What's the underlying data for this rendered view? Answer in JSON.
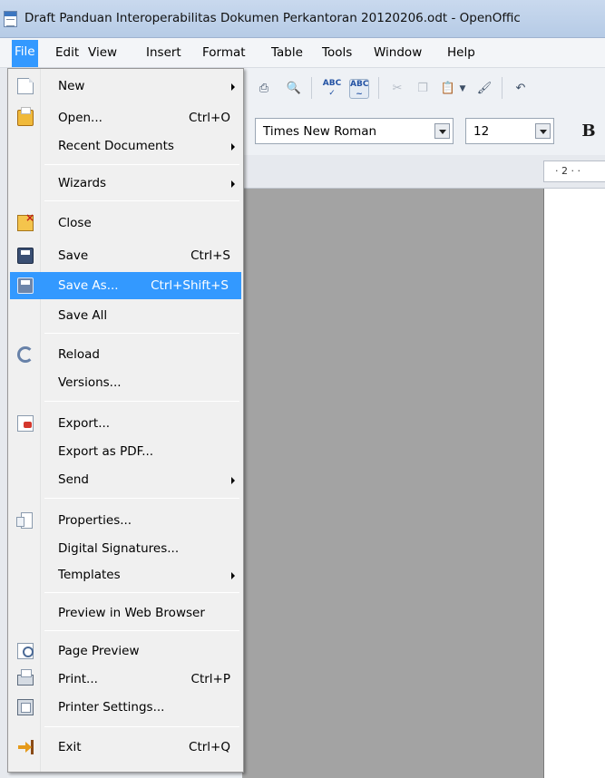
{
  "window": {
    "title": "Draft Panduan Interoperabilitas Dokumen Perkantoran 20120206.odt - OpenOffic"
  },
  "menubar": {
    "items": [
      "File",
      "Edit",
      "View",
      "Insert",
      "Format",
      "Table",
      "Tools",
      "Window",
      "Help"
    ],
    "open_menu": "File"
  },
  "format_toolbar": {
    "font_name": "Times New Roman",
    "font_size": "12",
    "bold_label": "B"
  },
  "toolbar": {
    "spell_label": "ABC",
    "autospell_label": "ABC"
  },
  "ruler": {
    "visible_label": "· 2 · ·"
  },
  "file_menu": {
    "items": [
      {
        "label": "New",
        "shortcut": "",
        "submenu": true,
        "icon": "new-document-icon"
      },
      {
        "label": "Open...",
        "shortcut": "Ctrl+O",
        "submenu": false,
        "icon": "open-folder-icon"
      },
      {
        "label": "Recent Documents",
        "shortcut": "",
        "submenu": true,
        "icon": ""
      },
      {
        "label": "Wizards",
        "shortcut": "",
        "submenu": true,
        "icon": ""
      },
      {
        "label": "Close",
        "shortcut": "",
        "submenu": false,
        "icon": "close-document-icon"
      },
      {
        "label": "Save",
        "shortcut": "Ctrl+S",
        "submenu": false,
        "icon": "save-icon"
      },
      {
        "label": "Save As...",
        "shortcut": "Ctrl+Shift+S",
        "submenu": false,
        "icon": "save-as-icon",
        "highlighted": true
      },
      {
        "label": "Save All",
        "shortcut": "",
        "submenu": false,
        "icon": ""
      },
      {
        "label": "Reload",
        "shortcut": "",
        "submenu": false,
        "icon": "reload-icon"
      },
      {
        "label": "Versions...",
        "shortcut": "",
        "submenu": false,
        "icon": ""
      },
      {
        "label": "Export...",
        "shortcut": "",
        "submenu": false,
        "icon": "export-icon"
      },
      {
        "label": "Export as PDF...",
        "shortcut": "",
        "submenu": false,
        "icon": ""
      },
      {
        "label": "Send",
        "shortcut": "",
        "submenu": true,
        "icon": ""
      },
      {
        "label": "Properties...",
        "shortcut": "",
        "submenu": false,
        "icon": "properties-icon"
      },
      {
        "label": "Digital Signatures...",
        "shortcut": "",
        "submenu": false,
        "icon": ""
      },
      {
        "label": "Templates",
        "shortcut": "",
        "submenu": true,
        "icon": ""
      },
      {
        "label": "Preview in Web Browser",
        "shortcut": "",
        "submenu": false,
        "icon": ""
      },
      {
        "label": "Page Preview",
        "shortcut": "",
        "submenu": false,
        "icon": "page-preview-icon"
      },
      {
        "label": "Print...",
        "shortcut": "Ctrl+P",
        "submenu": false,
        "icon": "print-icon"
      },
      {
        "label": "Printer Settings...",
        "shortcut": "",
        "submenu": false,
        "icon": "printer-settings-icon"
      },
      {
        "label": "Exit",
        "shortcut": "Ctrl+Q",
        "submenu": false,
        "icon": "exit-icon"
      }
    ]
  },
  "colors": {
    "menu_highlight": "#3399ff",
    "document_background": "#a3a3a3"
  }
}
